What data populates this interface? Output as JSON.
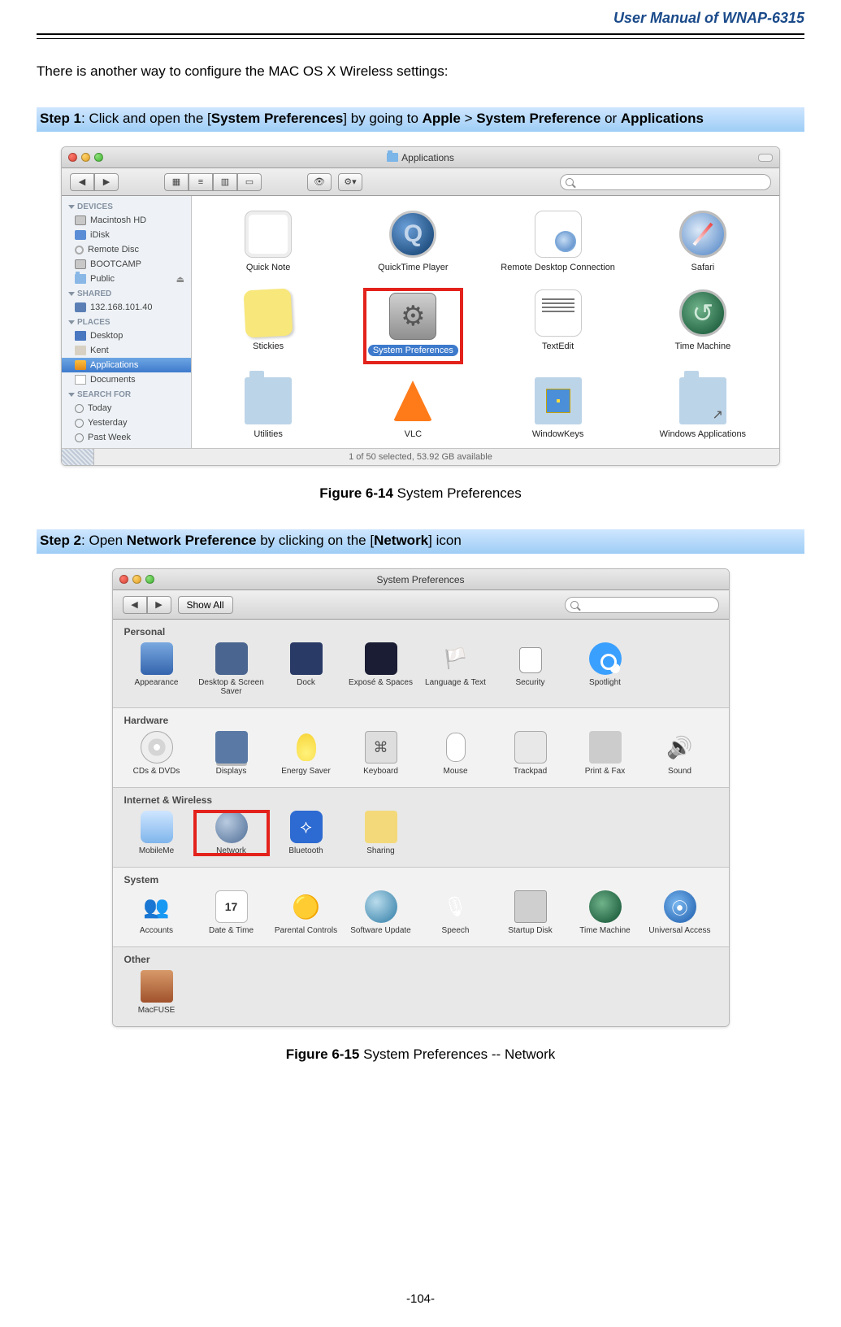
{
  "doc_title": "User Manual of WNAP-6315",
  "intro": "There is another way to configure the MAC OS X Wireless settings:",
  "step1": {
    "label": "Step 1",
    "t1": ": Click and open the [",
    "b1": "System Preferences",
    "t2": "] by going to ",
    "b2": "Apple",
    "t3": " > ",
    "b3": "System Preference",
    "t4": " or ",
    "b4": "Applications"
  },
  "finder": {
    "title": "Applications",
    "search_placeholder": "",
    "sidebar": {
      "devices_h": "DEVICES",
      "devices": [
        "Macintosh HD",
        "iDisk",
        "Remote Disc",
        "BOOTCAMP",
        "Public"
      ],
      "shared_h": "SHARED",
      "shared": [
        "132.168.101.40"
      ],
      "places_h": "PLACES",
      "places": [
        "Desktop",
        "Kent",
        "Applications",
        "Documents"
      ],
      "search_h": "SEARCH FOR",
      "search": [
        "Today",
        "Yesterday",
        "Past Week"
      ]
    },
    "apps": [
      "Quick Note",
      "QuickTime Player",
      "Remote Desktop Connection",
      "Safari",
      "Stickies",
      "System Preferences",
      "TextEdit",
      "Time Machine",
      "Utilities",
      "VLC",
      "WindowKeys",
      "Windows Applications"
    ],
    "status": "1 of 50 selected, 53.92 GB available"
  },
  "caption1": {
    "bold": "Figure 6-14",
    "rest": " System Preferences"
  },
  "step2": {
    "label": "Step 2",
    "t1": ": Open ",
    "b1": "Network Preference",
    "t2": " by clicking on the [",
    "b2": "Network",
    "t3": "] icon"
  },
  "sysprefs": {
    "title": "System Preferences",
    "show_all": "Show All",
    "sections": {
      "personal": {
        "label": "Personal",
        "items": [
          "Appearance",
          "Desktop & Screen Saver",
          "Dock",
          "Exposé & Spaces",
          "Language & Text",
          "Security",
          "Spotlight"
        ]
      },
      "hardware": {
        "label": "Hardware",
        "items": [
          "CDs & DVDs",
          "Displays",
          "Energy Saver",
          "Keyboard",
          "Mouse",
          "Trackpad",
          "Print & Fax",
          "Sound"
        ]
      },
      "internet": {
        "label": "Internet & Wireless",
        "items": [
          "MobileMe",
          "Network",
          "Bluetooth",
          "Sharing"
        ]
      },
      "system": {
        "label": "System",
        "items": [
          "Accounts",
          "Date & Time",
          "Parental Controls",
          "Software Update",
          "Speech",
          "Startup Disk",
          "Time Machine",
          "Universal Access"
        ]
      },
      "other": {
        "label": "Other",
        "items": [
          "MacFUSE"
        ]
      }
    }
  },
  "caption2": {
    "bold": "Figure 6-15",
    "rest": " System Preferences -- Network"
  },
  "page_num": "-104-"
}
